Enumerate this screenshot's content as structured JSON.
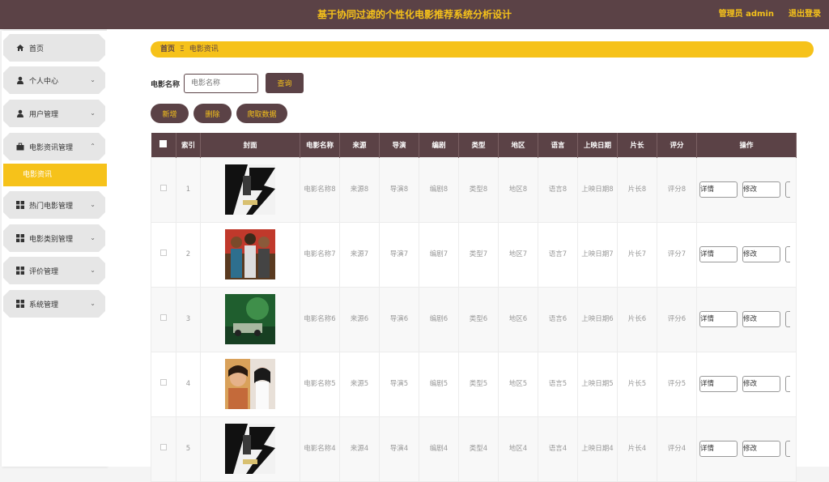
{
  "header": {
    "title": "基于协同过滤的个性化电影推荐系统分析设计",
    "user": "管理员 admin",
    "logout": "退出登录"
  },
  "sidebar": {
    "items": [
      {
        "label": "首页",
        "icon": "home-icon"
      },
      {
        "label": "个人中心",
        "icon": "user-icon"
      },
      {
        "label": "用户管理",
        "icon": "user-icon"
      },
      {
        "label": "电影资讯管理",
        "icon": "briefcase-icon"
      },
      {
        "label": "热门电影管理",
        "icon": "grid-icon"
      },
      {
        "label": "电影类别管理",
        "icon": "grid-icon"
      },
      {
        "label": "评价管理",
        "icon": "grid-icon"
      },
      {
        "label": "系统管理",
        "icon": "grid-icon"
      }
    ],
    "active_sub": "电影资讯"
  },
  "breadcrumb": {
    "home": "首页",
    "separator": "Ξ",
    "current": "电影资讯"
  },
  "search": {
    "label": "电影名称",
    "placeholder": "电影名称",
    "button": "查询"
  },
  "actions": {
    "add": "新增",
    "delete": "删除",
    "crawl": "爬取数据"
  },
  "table": {
    "headers": [
      "索引",
      "封面",
      "电影名称",
      "来源",
      "导演",
      "编剧",
      "类型",
      "地区",
      "语言",
      "上映日期",
      "片长",
      "评分",
      "操作"
    ],
    "detail_label": "详情",
    "edit_label": "修改",
    "rows": [
      {
        "index": "1",
        "poster": "poster-a",
        "name": "电影名称8",
        "source": "来源8",
        "director": "导演8",
        "writer": "编剧8",
        "type": "类型8",
        "region": "地区8",
        "language": "语言8",
        "release": "上映日期8",
        "length": "片长8",
        "rating": "评分8"
      },
      {
        "index": "2",
        "poster": "poster-b",
        "name": "电影名称7",
        "source": "来源7",
        "director": "导演7",
        "writer": "编剧7",
        "type": "类型7",
        "region": "地区7",
        "language": "语言7",
        "release": "上映日期7",
        "length": "片长7",
        "rating": "评分7"
      },
      {
        "index": "3",
        "poster": "poster-c",
        "name": "电影名称6",
        "source": "来源6",
        "director": "导演6",
        "writer": "编剧6",
        "type": "类型6",
        "region": "地区6",
        "language": "语言6",
        "release": "上映日期6",
        "length": "片长6",
        "rating": "评分6"
      },
      {
        "index": "4",
        "poster": "poster-d",
        "name": "电影名称5",
        "source": "来源5",
        "director": "导演5",
        "writer": "编剧5",
        "type": "类型5",
        "region": "地区5",
        "language": "语言5",
        "release": "上映日期5",
        "length": "片长5",
        "rating": "评分5"
      },
      {
        "index": "5",
        "poster": "poster-a",
        "name": "电影名称4",
        "source": "来源4",
        "director": "导演4",
        "writer": "编剧4",
        "type": "类型4",
        "region": "地区4",
        "language": "语言4",
        "release": "上映日期4",
        "length": "片长4",
        "rating": "评分4"
      }
    ]
  },
  "colors": {
    "brand": "#5b4246",
    "accent": "#f6c21a"
  }
}
